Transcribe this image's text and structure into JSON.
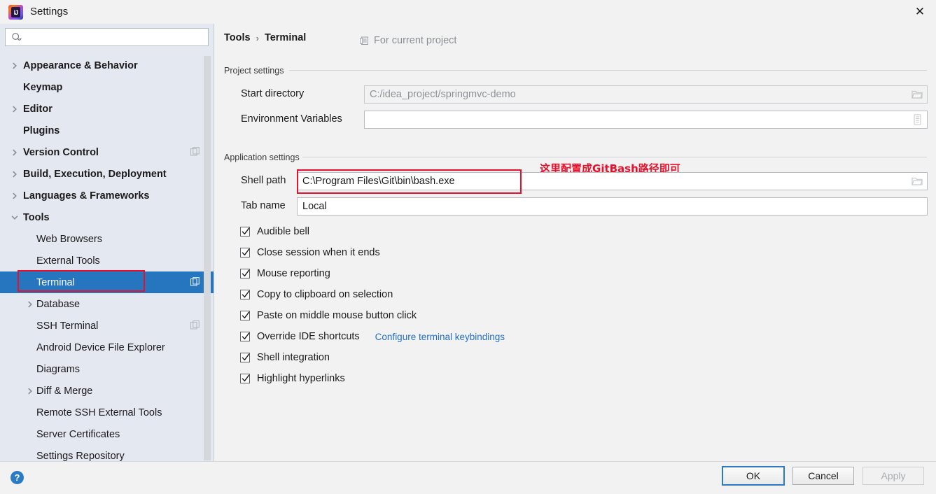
{
  "window": {
    "title": "Settings",
    "logo_icon": "intellij-idea-logo",
    "close_icon": "close-icon"
  },
  "sidebar": {
    "search": {
      "placeholder": "",
      "value": "",
      "icon": "search-icon"
    },
    "items": [
      {
        "label": "Appearance & Behavior",
        "level": 0,
        "arrow": "collapsed",
        "badge": false,
        "selected": false
      },
      {
        "label": "Keymap",
        "level": 0,
        "arrow": "none",
        "badge": false,
        "selected": false
      },
      {
        "label": "Editor",
        "level": 0,
        "arrow": "collapsed",
        "badge": false,
        "selected": false
      },
      {
        "label": "Plugins",
        "level": 0,
        "arrow": "none",
        "badge": false,
        "selected": false
      },
      {
        "label": "Version Control",
        "level": 0,
        "arrow": "collapsed",
        "badge": true,
        "selected": false
      },
      {
        "label": "Build, Execution, Deployment",
        "level": 0,
        "arrow": "collapsed",
        "badge": false,
        "selected": false
      },
      {
        "label": "Languages & Frameworks",
        "level": 0,
        "arrow": "collapsed",
        "badge": false,
        "selected": false
      },
      {
        "label": "Tools",
        "level": 0,
        "arrow": "expanded",
        "badge": false,
        "selected": false
      },
      {
        "label": "Web Browsers",
        "level": 1,
        "arrow": "none",
        "badge": false,
        "selected": false
      },
      {
        "label": "External Tools",
        "level": 1,
        "arrow": "none",
        "badge": false,
        "selected": false
      },
      {
        "label": "Terminal",
        "level": 1,
        "arrow": "none",
        "badge": true,
        "selected": true
      },
      {
        "label": "Database",
        "level": 1,
        "arrow": "collapsed",
        "badge": false,
        "selected": false
      },
      {
        "label": "SSH Terminal",
        "level": 1,
        "arrow": "none",
        "badge": true,
        "selected": false
      },
      {
        "label": "Android Device File Explorer",
        "level": 1,
        "arrow": "none",
        "badge": false,
        "selected": false
      },
      {
        "label": "Diagrams",
        "level": 1,
        "arrow": "none",
        "badge": false,
        "selected": false
      },
      {
        "label": "Diff & Merge",
        "level": 1,
        "arrow": "collapsed",
        "badge": false,
        "selected": false
      },
      {
        "label": "Remote SSH External Tools",
        "level": 1,
        "arrow": "none",
        "badge": false,
        "selected": false
      },
      {
        "label": "Server Certificates",
        "level": 1,
        "arrow": "none",
        "badge": false,
        "selected": false
      },
      {
        "label": "Settings Repository",
        "level": 1,
        "arrow": "none",
        "badge": false,
        "selected": false
      }
    ]
  },
  "content": {
    "breadcrumb": {
      "parent": "Tools",
      "separator": "›",
      "current": "Terminal"
    },
    "for_current_project": {
      "label": "For current project",
      "icon": "project-scope-icon"
    },
    "project_settings": {
      "group_title": "Project settings",
      "start_directory": {
        "label": "Start directory",
        "value": "C:/idea_project/springmvc-demo",
        "browse_icon": "folder-icon"
      },
      "environment_variables": {
        "label": "Environment Variables",
        "value": "",
        "browse_icon": "variables-list-icon"
      }
    },
    "application_settings": {
      "group_title": "Application settings",
      "shell_path": {
        "label": "Shell path",
        "value": "C:\\Program Files\\Git\\bin\\bash.exe",
        "browse_icon": "folder-icon"
      },
      "tab_name": {
        "label": "Tab name",
        "value": "Local"
      },
      "checkboxes": [
        {
          "label": "Audible bell",
          "checked": true,
          "link": null
        },
        {
          "label": "Close session when it ends",
          "checked": true,
          "link": null
        },
        {
          "label": "Mouse reporting",
          "checked": true,
          "link": null
        },
        {
          "label": "Copy to clipboard on selection",
          "checked": true,
          "link": null
        },
        {
          "label": "Paste on middle mouse button click",
          "checked": true,
          "link": null
        },
        {
          "label": "Override IDE shortcuts",
          "checked": true,
          "link": "Configure terminal keybindings"
        },
        {
          "label": "Shell integration",
          "checked": true,
          "link": null
        },
        {
          "label": "Highlight hyperlinks",
          "checked": true,
          "link": null
        }
      ]
    }
  },
  "annotations": {
    "note_text": "这里配置成GitBash路径即可",
    "color": "#e8102a"
  },
  "footer": {
    "help_icon": "help-icon",
    "help_glyph": "?",
    "ok": "OK",
    "cancel": "Cancel",
    "apply": "Apply"
  },
  "colors": {
    "selection_blue": "#2675bf",
    "link_blue": "#2470c4",
    "sidebar_bg": "#e4e8f0",
    "annotation_red": "#e8102a"
  }
}
